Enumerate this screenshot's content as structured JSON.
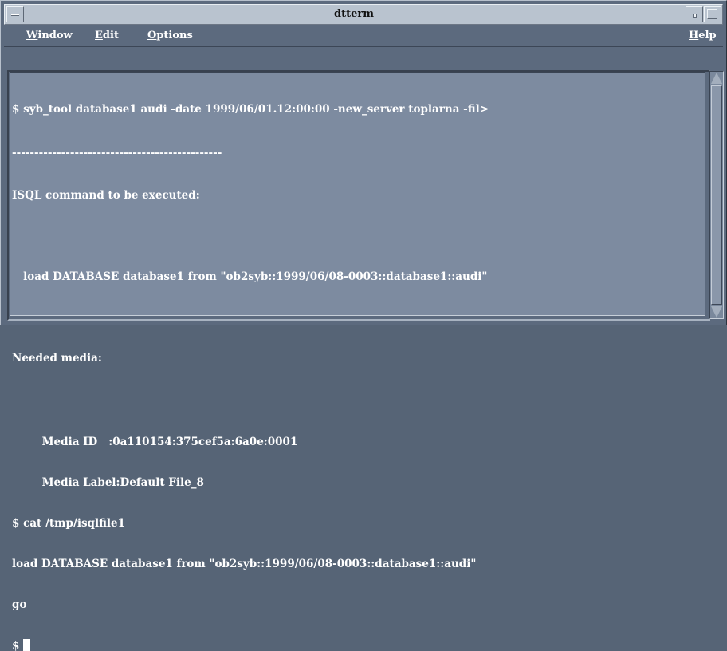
{
  "window": {
    "title": "dtterm"
  },
  "menubar": {
    "window": "Window",
    "edit": "Edit",
    "options": "Options",
    "help": "Help"
  },
  "terminal": {
    "lines": [
      "$ syb_tool database1 audi -date 1999/06/01.12:00:00 -new_server toplarna -fil>",
      "-----------------------------------------------",
      "ISQL command to be executed:",
      "",
      "   load DATABASE database1 from \"ob2syb::1999/06/08-0003::database1::audi\"",
      "",
      "Needed media:",
      "",
      "        Media ID   :0a110154:375cef5a:6a0e:0001",
      "        Media Label:Default File_8",
      "$ cat /tmp/isqlfile1",
      "load DATABASE database1 from \"ob2syb::1999/06/08-0003::database1::audi\"",
      "go",
      "$ "
    ]
  },
  "colors": {
    "terminal_bg": "#7d8ba0",
    "window_bg": "#5c6a7e",
    "titlebar_bg": "#b9c3cf",
    "text": "#ffffff"
  }
}
